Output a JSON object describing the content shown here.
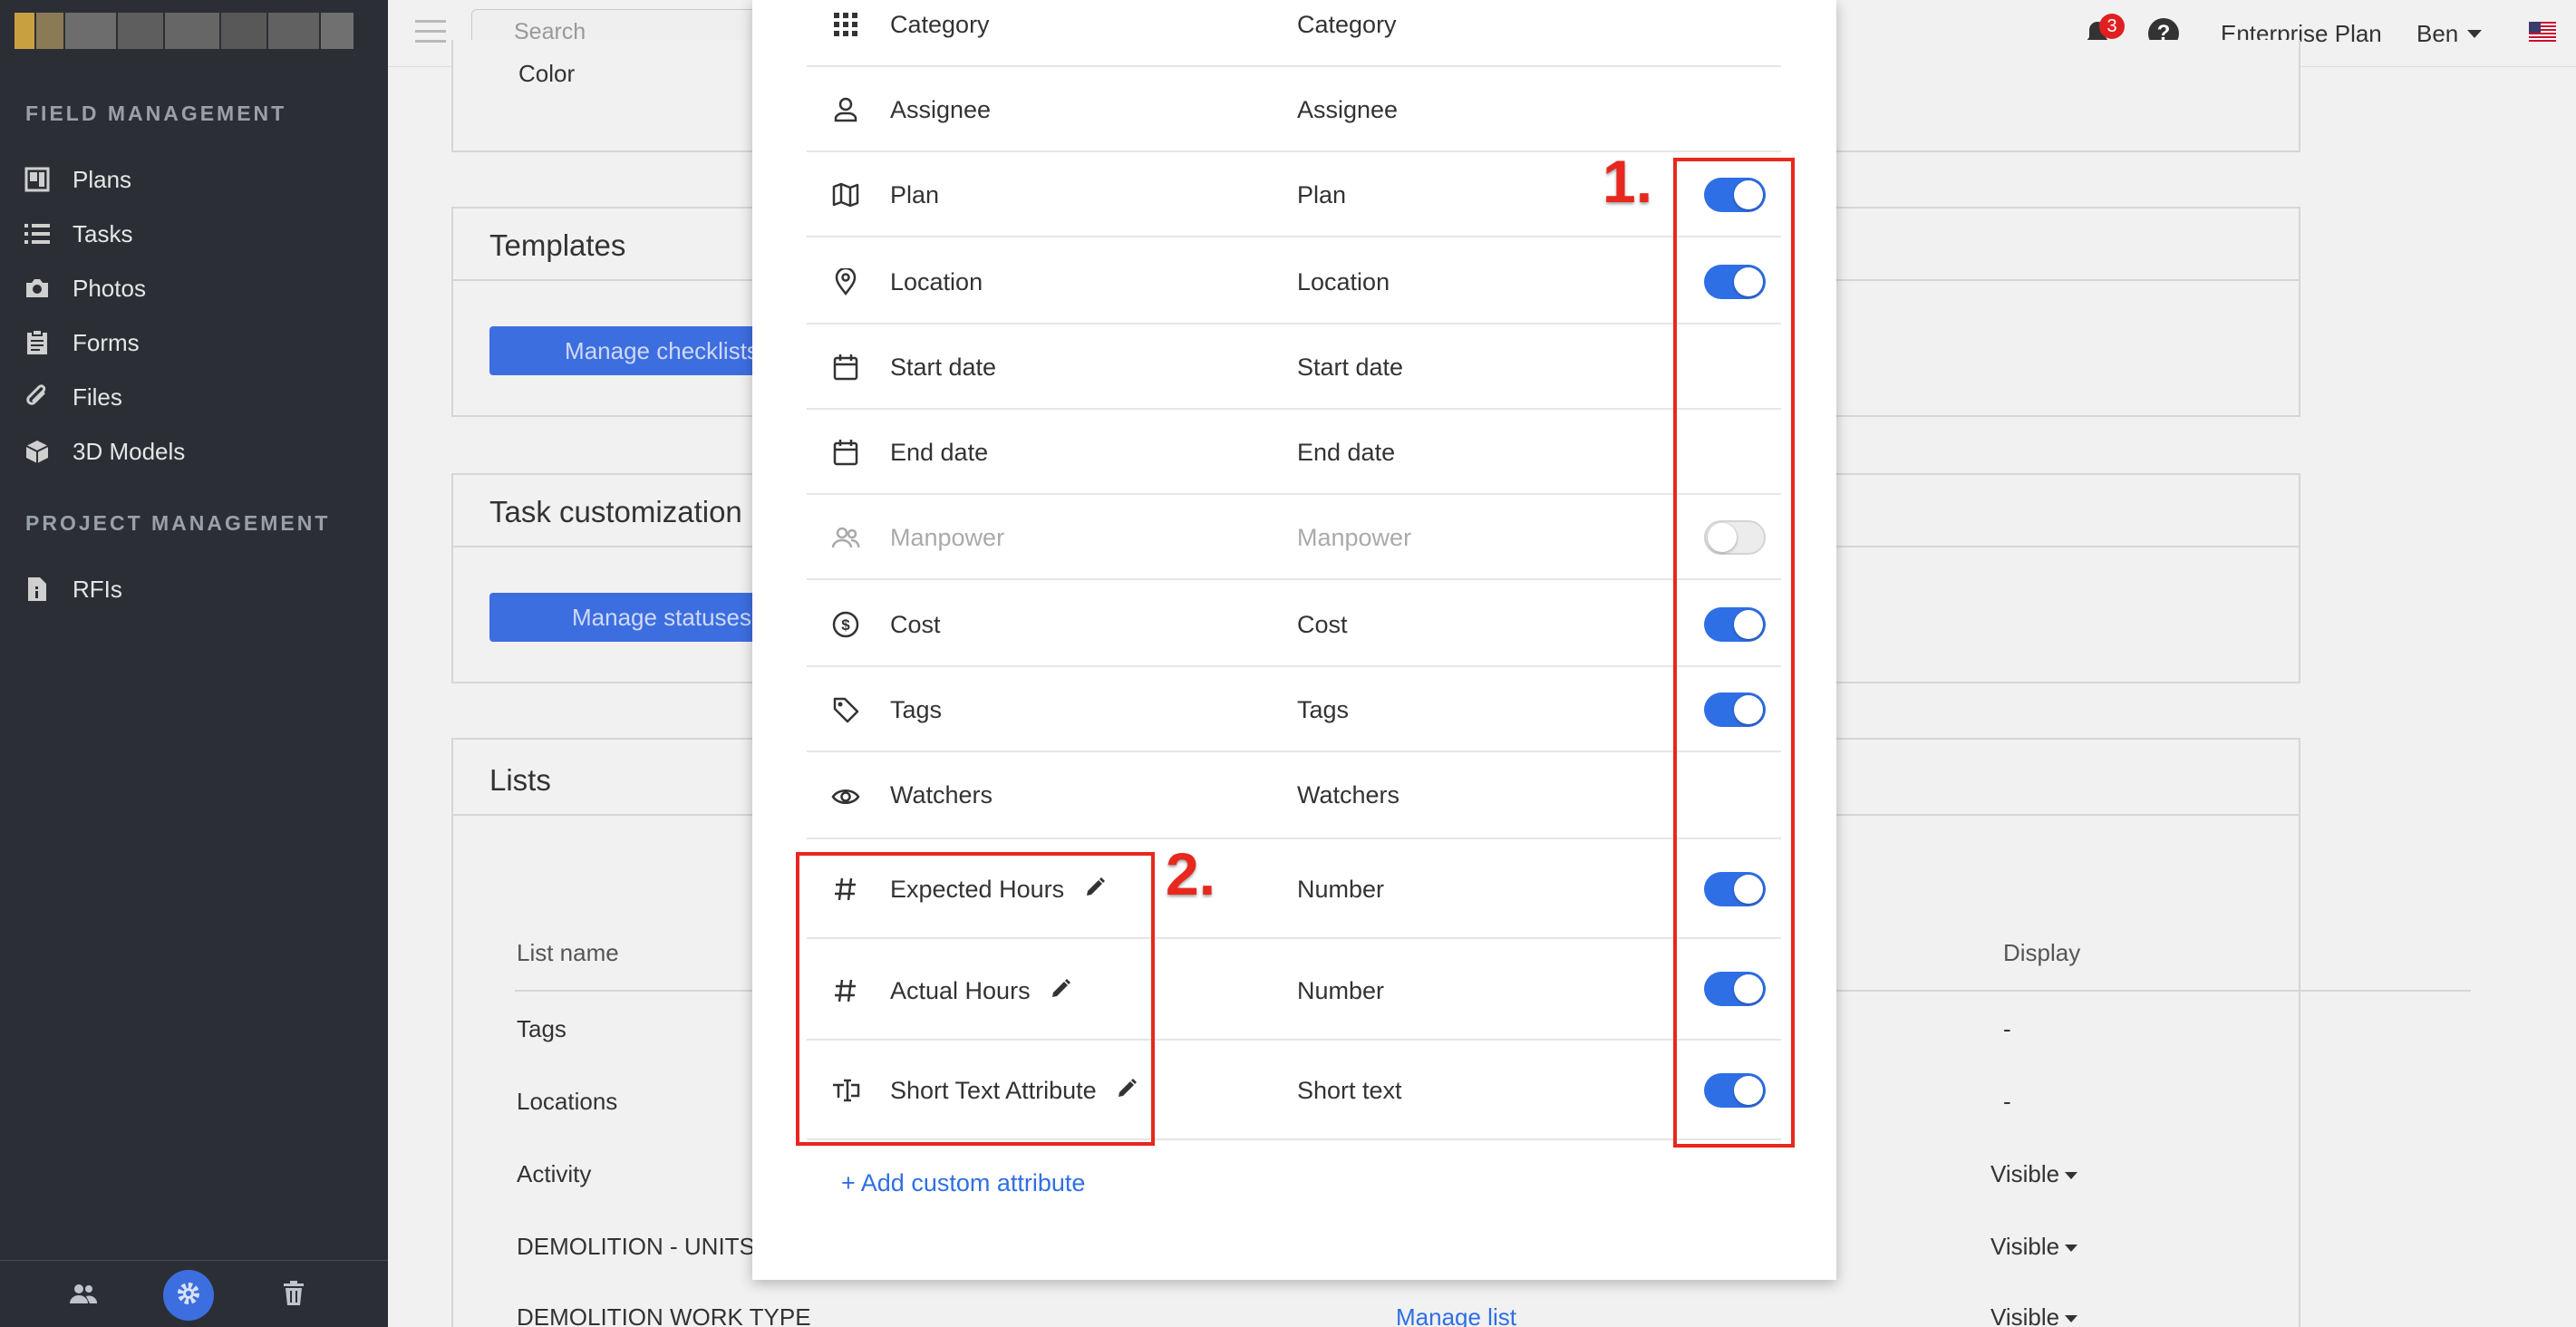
{
  "sidebar": {
    "section_field": "FIELD MANAGEMENT",
    "section_project": "PROJECT MANAGEMENT",
    "items": [
      {
        "label": "Plans",
        "icon": "plans-icon"
      },
      {
        "label": "Tasks",
        "icon": "tasks-icon"
      },
      {
        "label": "Photos",
        "icon": "camera-icon"
      },
      {
        "label": "Forms",
        "icon": "forms-icon"
      },
      {
        "label": "Files",
        "icon": "paperclip-icon"
      },
      {
        "label": "3D Models",
        "icon": "cube-icon"
      }
    ],
    "project_items": [
      {
        "label": "RFIs",
        "icon": "rfi-icon"
      }
    ]
  },
  "topbar": {
    "search_placeholder": "Search",
    "notification_count": "3",
    "help": "?",
    "plan": "Enterprise Plan",
    "user": "Ben"
  },
  "background": {
    "color_label": "Color",
    "templates_title": "Templates",
    "manage_checklists": "Manage checklists",
    "task_custom_title": "Task customization",
    "manage_statuses": "Manage statuses",
    "lists_title": "Lists",
    "lists_header_name": "List name",
    "lists_header_display": "Display",
    "lists_rows": [
      {
        "name": "Tags",
        "display": "-"
      },
      {
        "name": "Locations",
        "display": "-"
      },
      {
        "name": "Activity",
        "display": "Visible"
      },
      {
        "name": "DEMOLITION - UNITS",
        "display": "Visible"
      },
      {
        "name": "DEMOLITION WORK TYPE",
        "display": "Visible",
        "link": "Manage list"
      }
    ]
  },
  "modal": {
    "fields": [
      {
        "name": "Category",
        "type": "Category",
        "icon": "grid-icon",
        "toggle": null
      },
      {
        "name": "Assignee",
        "type": "Assignee",
        "icon": "person-icon",
        "toggle": null
      },
      {
        "name": "Plan",
        "type": "Plan",
        "icon": "map-icon",
        "toggle": "on"
      },
      {
        "name": "Location",
        "type": "Location",
        "icon": "location-pin-icon",
        "toggle": "on"
      },
      {
        "name": "Start date",
        "type": "Start date",
        "icon": "calendar-icon",
        "toggle": null
      },
      {
        "name": "End date",
        "type": "End date",
        "icon": "calendar-icon",
        "toggle": null
      },
      {
        "name": "Manpower",
        "type": "Manpower",
        "icon": "people-icon",
        "toggle": "off"
      },
      {
        "name": "Cost",
        "type": "Cost",
        "icon": "dollar-icon",
        "toggle": "on"
      },
      {
        "name": "Tags",
        "type": "Tags",
        "icon": "tag-icon",
        "toggle": "on"
      },
      {
        "name": "Watchers",
        "type": "Watchers",
        "icon": "eye-icon",
        "toggle": null
      },
      {
        "name": "Expected Hours",
        "type": "Number",
        "icon": "hash-icon",
        "toggle": "on",
        "editable": true
      },
      {
        "name": "Actual Hours",
        "type": "Number",
        "icon": "hash-icon",
        "toggle": "on",
        "editable": true
      },
      {
        "name": "Short Text Attribute",
        "type": "Short text",
        "icon": "text-field-icon",
        "toggle": "on",
        "editable": true
      }
    ],
    "add_custom": "+ Add custom attribute"
  },
  "annotations": {
    "one": "1.",
    "two": "2."
  },
  "colors": {
    "accent": "#2f6fe6",
    "annotation": "#e8271e",
    "sidebar": "#2b2f35"
  }
}
